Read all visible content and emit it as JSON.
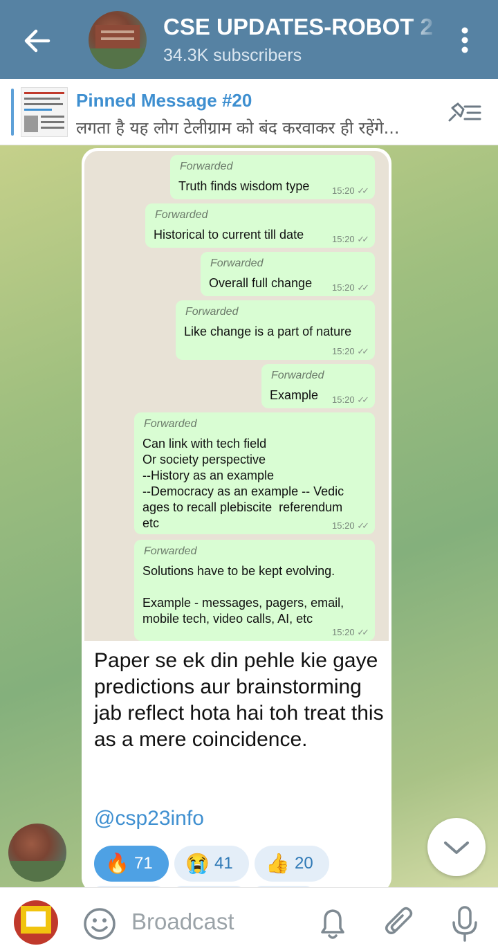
{
  "header": {
    "title": "CSE UPDATES-ROBOT 2",
    "subscribers": "34.3K subscribers",
    "back_icon": "arrow-left-icon",
    "menu_icon": "more-vertical-icon"
  },
  "pinned": {
    "title": "Pinned Message #20",
    "text": "लगता है यह लोग टेलीग्राम को बंद करवाकर ही रहेंगे..."
  },
  "message": {
    "screenshot_bubbles": [
      {
        "label": "Forwarded",
        "text": "Truth finds wisdom type",
        "time": "15:20"
      },
      {
        "label": "Forwarded",
        "text": "Historical to current till date",
        "time": "15:20"
      },
      {
        "label": "Forwarded",
        "text": "Overall full change",
        "time": "15:20"
      },
      {
        "label": "Forwarded",
        "text": "Like change is a part of nature",
        "time": "15:20"
      },
      {
        "label": "Forwarded",
        "text": "Example",
        "time": "15:20"
      },
      {
        "label": "Forwarded",
        "text": "Can link with tech field\nOr society perspective\n--History as an example\n--Democracy as an example -- Vedic\nages to recall plebiscite  referendum\netc",
        "time": "15:20"
      },
      {
        "label": "Forwarded",
        "text": "Solutions have to be kept evolving.\n\nExample - messages, pagers, email,\nmobile tech, video calls, AI, etc",
        "time": "15:20"
      }
    ],
    "caption": "Paper se ek din pehle kie gaye predictions aur brainstorming jab reflect hota hai toh treat this as a mere coincidence.",
    "link": "@csp23info",
    "reactions": [
      {
        "emoji": "🔥",
        "count": "71",
        "active": true
      },
      {
        "emoji": "😭",
        "count": "41",
        "active": false
      },
      {
        "emoji": "👍",
        "count": "20",
        "active": false
      }
    ]
  },
  "bottom_bar": {
    "placeholder": "Broadcast",
    "emoji_icon": "smiley-icon",
    "bell_icon": "bell-icon",
    "attach_icon": "paperclip-icon",
    "mic_icon": "microphone-icon"
  },
  "colors": {
    "header": "#5682a3",
    "accent": "#3e8fd0",
    "bubble": "#d9fdd3",
    "reaction_active": "#4ea1e4"
  }
}
